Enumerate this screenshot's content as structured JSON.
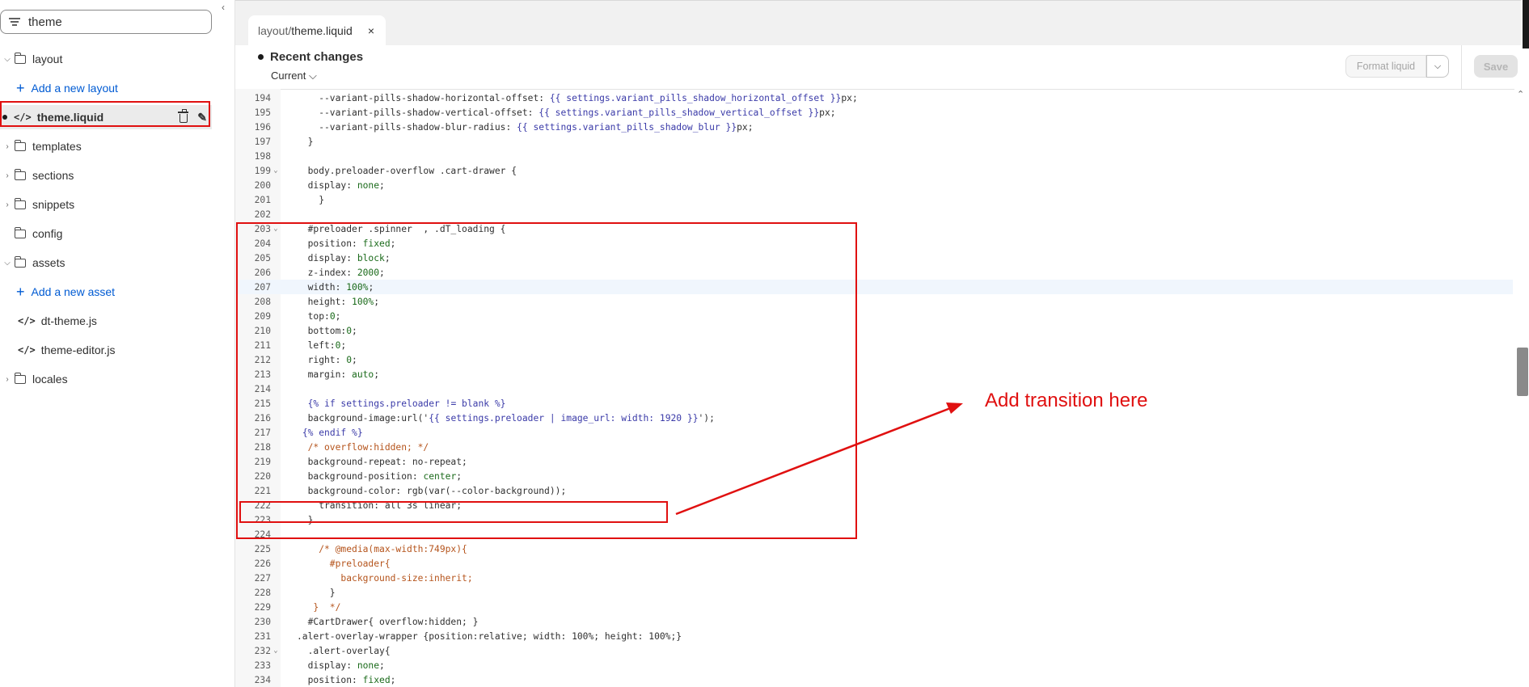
{
  "sidebar": {
    "search_value": "theme",
    "items": [
      {
        "type": "folder",
        "label": "layout",
        "expanded": true
      },
      {
        "type": "add",
        "label": "Add a new layout"
      },
      {
        "type": "file",
        "label": "theme.liquid",
        "active": true
      },
      {
        "type": "folder",
        "label": "templates",
        "expanded": false
      },
      {
        "type": "folder",
        "label": "sections",
        "expanded": false
      },
      {
        "type": "folder",
        "label": "snippets",
        "expanded": false
      },
      {
        "type": "folder",
        "label": "config",
        "expanded": false
      },
      {
        "type": "folder",
        "label": "assets",
        "expanded": true
      },
      {
        "type": "add",
        "label": "Add a new asset"
      },
      {
        "type": "file",
        "label": "dt-theme.js"
      },
      {
        "type": "file",
        "label": "theme-editor.js"
      },
      {
        "type": "folder",
        "label": "locales",
        "expanded": false
      }
    ]
  },
  "tab": {
    "folder": "layout/",
    "file": "theme.liquid",
    "close": "×"
  },
  "toolbar": {
    "recent_changes": "Recent changes",
    "current": "Current",
    "format_label": "Format liquid",
    "save_label": "Save"
  },
  "code_lines": [
    {
      "n": "194",
      "text": "    --variant-pills-shadow-horizontal-offset: {{ settings.variant_pills_shadow_horizontal_offset }}px;"
    },
    {
      "n": "195",
      "text": "    --variant-pills-shadow-vertical-offset: {{ settings.variant_pills_shadow_vertical_offset }}px;"
    },
    {
      "n": "196",
      "text": "    --variant-pills-shadow-blur-radius: {{ settings.variant_pills_shadow_blur }}px;"
    },
    {
      "n": "197",
      "text": "  }"
    },
    {
      "n": "198",
      "text": ""
    },
    {
      "n": "199",
      "text": "  body.preloader-overflow .cart-drawer {",
      "fold": true
    },
    {
      "n": "200",
      "text": "  display: none;"
    },
    {
      "n": "201",
      "text": "    }"
    },
    {
      "n": "202",
      "text": ""
    },
    {
      "n": "203",
      "text": "  #preloader .spinner  , .dT_loading {",
      "fold": true
    },
    {
      "n": "204",
      "text": "  position: fixed;"
    },
    {
      "n": "205",
      "text": "  display: block;"
    },
    {
      "n": "206",
      "text": "  z-index: 2000;"
    },
    {
      "n": "207",
      "text": "  width: 100%;",
      "highlight": true
    },
    {
      "n": "208",
      "text": "  height: 100%;"
    },
    {
      "n": "209",
      "text": "  top:0;"
    },
    {
      "n": "210",
      "text": "  bottom:0;"
    },
    {
      "n": "211",
      "text": "  left:0;"
    },
    {
      "n": "212",
      "text": "  right: 0;"
    },
    {
      "n": "213",
      "text": "  margin: auto;"
    },
    {
      "n": "214",
      "text": ""
    },
    {
      "n": "215",
      "text": "  {% if settings.preloader != blank %}"
    },
    {
      "n": "216",
      "text": "  background-image:url('{{ settings.preloader | image_url: width: 1920 }}');"
    },
    {
      "n": "217",
      "text": " {% endif %}"
    },
    {
      "n": "218",
      "text": "  /* overflow:hidden; */"
    },
    {
      "n": "219",
      "text": "  background-repeat: no-repeat;"
    },
    {
      "n": "220",
      "text": "  background-position: center;"
    },
    {
      "n": "221",
      "text": "  background-color: rgb(var(--color-background));"
    },
    {
      "n": "222",
      "text": "    transition: all 3s linear;"
    },
    {
      "n": "223",
      "text": "  }"
    },
    {
      "n": "224",
      "text": ""
    },
    {
      "n": "225",
      "text": "    /* @media(max-width:749px){"
    },
    {
      "n": "226",
      "text": "      #preloader{"
    },
    {
      "n": "227",
      "text": "        background-size:inherit;"
    },
    {
      "n": "228",
      "text": "      }"
    },
    {
      "n": "229",
      "text": "   }  */"
    },
    {
      "n": "230",
      "text": "  #CartDrawer{ overflow:hidden; }"
    },
    {
      "n": "231",
      "text": ".alert-overlay-wrapper {position:relative; width: 100%; height: 100%;}"
    },
    {
      "n": "232",
      "text": "  .alert-overlay{",
      "fold": true
    },
    {
      "n": "233",
      "text": "  display: none;"
    },
    {
      "n": "234",
      "text": "  position: fixed;"
    }
  ],
  "annotation": {
    "text": "Add transition here",
    "color": "#e01010"
  },
  "colors": {
    "accent": "#005bd3",
    "annotation": "#e01010"
  }
}
